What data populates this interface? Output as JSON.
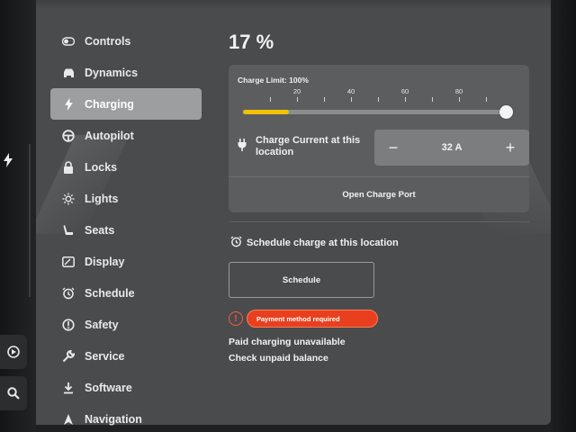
{
  "sidebar": {
    "items": [
      {
        "label": "Controls",
        "icon": "toggle-icon"
      },
      {
        "label": "Dynamics",
        "icon": "car-icon"
      },
      {
        "label": "Charging",
        "icon": "bolt-icon",
        "active": true
      },
      {
        "label": "Autopilot",
        "icon": "steering-wheel-icon"
      },
      {
        "label": "Locks",
        "icon": "lock-icon"
      },
      {
        "label": "Lights",
        "icon": "sun-icon"
      },
      {
        "label": "Seats",
        "icon": "seat-icon"
      },
      {
        "label": "Display",
        "icon": "display-icon"
      },
      {
        "label": "Schedule",
        "icon": "alarm-clock-icon"
      },
      {
        "label": "Safety",
        "icon": "info-circle-icon"
      },
      {
        "label": "Service",
        "icon": "wrench-icon"
      },
      {
        "label": "Software",
        "icon": "download-icon"
      },
      {
        "label": "Navigation",
        "icon": "navigation-arrow-icon"
      }
    ]
  },
  "charging": {
    "battery_percent": "17 %",
    "charge_limit_label": "Charge Limit: 100%",
    "charge_limit_value": 100,
    "current_level_fraction": 0.17,
    "tick_labels": [
      "20",
      "40",
      "60",
      "80"
    ],
    "charge_current_label": "Charge Current at this location",
    "current_value": "32 A",
    "minus_label": "−",
    "plus_label": "+",
    "open_port_label": "Open Charge Port",
    "schedule_title": "Schedule charge at this location",
    "schedule_button": "Schedule",
    "payment_badge": "Payment method required",
    "paid_unavailable": "Paid charging unavailable",
    "check_balance": "Check unpaid balance"
  },
  "colors": {
    "accent_yellow": "#f2c200",
    "warning_red": "#e8401f"
  }
}
